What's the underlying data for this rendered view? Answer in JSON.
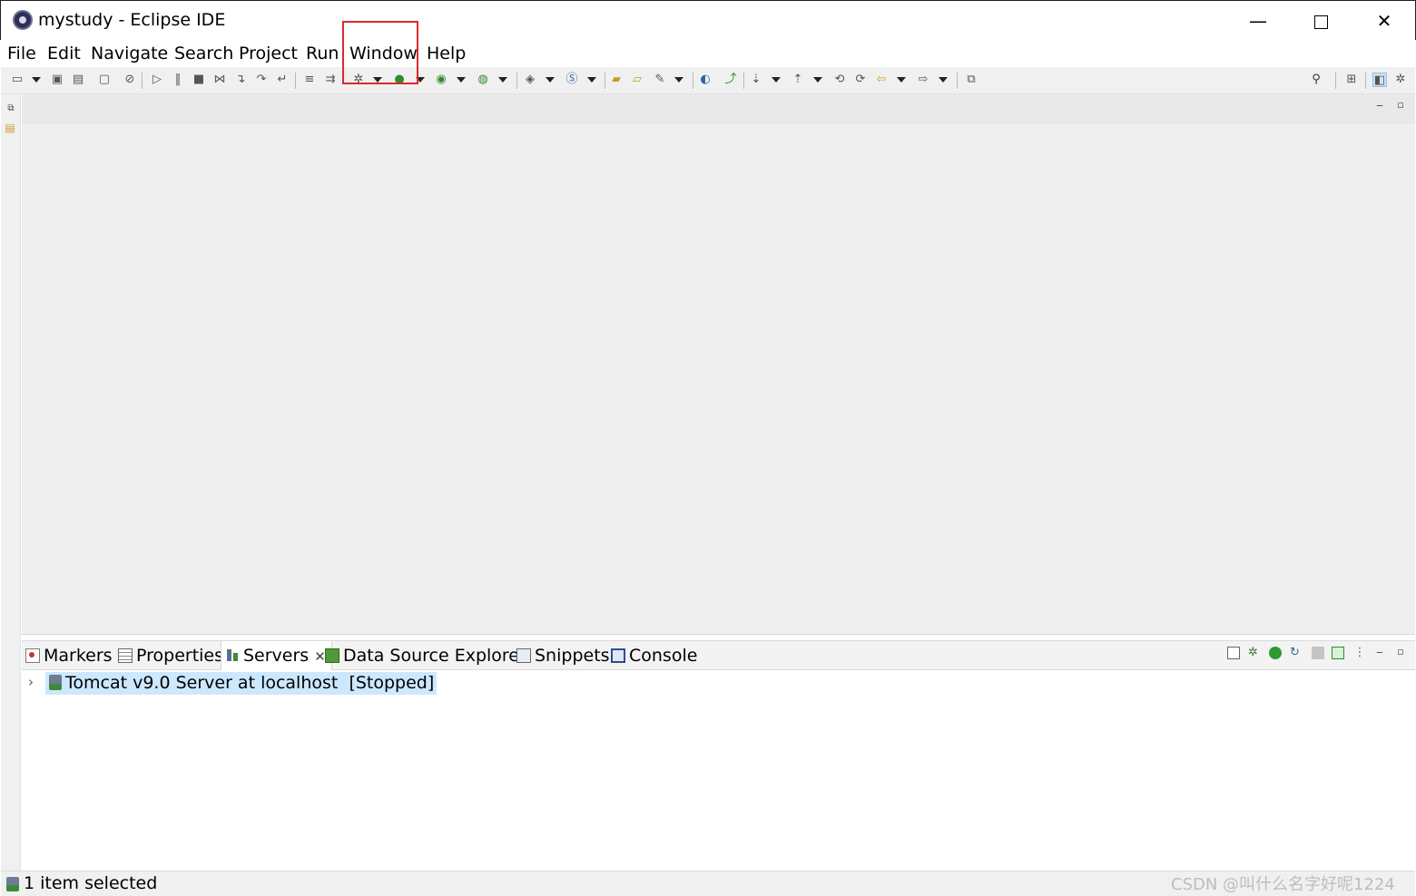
{
  "window": {
    "title": "mystudy - Eclipse IDE",
    "controls": {
      "minimize": "—",
      "close": "✕"
    }
  },
  "menubar": {
    "items": [
      "File",
      "Edit",
      "Navigate",
      "Search",
      "Project",
      "Run",
      "Window",
      "Help"
    ],
    "highlighted": "Window",
    "highlight_color": "#e0282e"
  },
  "toolbar": {
    "icons": [
      "new-icon",
      "save-icon",
      "save-all-icon",
      "terminal-icon",
      "skip-breakpoints-icon",
      "resume-icon",
      "suspend-icon",
      "terminate-icon",
      "disconnect-icon",
      "step-into-icon",
      "step-over-icon",
      "step-return-icon",
      "drop-to-frame-icon",
      "use-step-filters-icon",
      "debug-icon",
      "run-icon",
      "coverage-icon",
      "external-tools-icon",
      "new-java-project-icon",
      "new-class-icon",
      "open-type-icon",
      "open-task-icon",
      "search-icon",
      "web-browser-icon",
      "publish-icon",
      "next-annotation-icon",
      "previous-annotation-icon",
      "last-edit-icon",
      "back-icon",
      "forward-icon",
      "pin-editor-icon",
      "search-icon",
      "open-perspective-icon",
      "java-ee-perspective-icon",
      "debug-perspective-icon"
    ]
  },
  "bottom_panel": {
    "tabs": [
      {
        "label": "Markers",
        "icon": "markers-icon"
      },
      {
        "label": "Properties",
        "icon": "properties-icon"
      },
      {
        "label": "Servers",
        "icon": "servers-icon",
        "active": true,
        "close": "✕"
      },
      {
        "label": "Data Source Explorer",
        "icon": "data-source-explorer-icon"
      },
      {
        "label": "Snippets",
        "icon": "snippets-icon"
      },
      {
        "label": "Console",
        "icon": "console-icon"
      }
    ],
    "servers": [
      {
        "name": "Tomcat v9.0 Server at localhost",
        "state": "[Stopped]",
        "expand_glyph": "›"
      }
    ]
  },
  "statusbar": {
    "text": "1 item selected",
    "watermark": "CSDN @叫什么名字好呢1224"
  },
  "colors": {
    "selection": "#cce8ff",
    "editor_background": "#efefef",
    "toolbar_background": "#f0f0f0"
  }
}
